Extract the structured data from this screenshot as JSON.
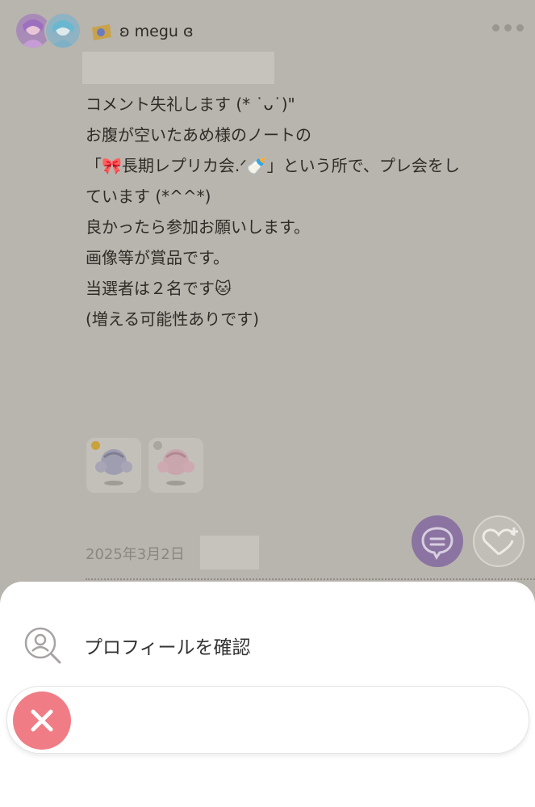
{
  "post": {
    "username": "ʚ megu ɞ",
    "body_lines": [
      "コメント失礼します (* ˙ᴗ˙)\"",
      "",
      "お腹が空いたあめ様のノートの",
      "「🎀長期レプリカ会.ᐟ🍼」という所で、プレ会をし",
      "ています (*^^*)",
      "",
      "良かったら参加お願いします。",
      "画像等が賞品です。",
      "当選者は２名です🐱",
      "(増える可能性ありです)"
    ],
    "date": "2025年3月2日"
  },
  "sheet": {
    "menu_items": [
      {
        "label": "プロフィールを確認",
        "icon": "profile-search-icon"
      }
    ],
    "close_icon": "close-icon"
  },
  "colors": {
    "overlay": "#b8b5ae",
    "chat_button": "#8b74a1",
    "close_button": "#f07d86"
  }
}
